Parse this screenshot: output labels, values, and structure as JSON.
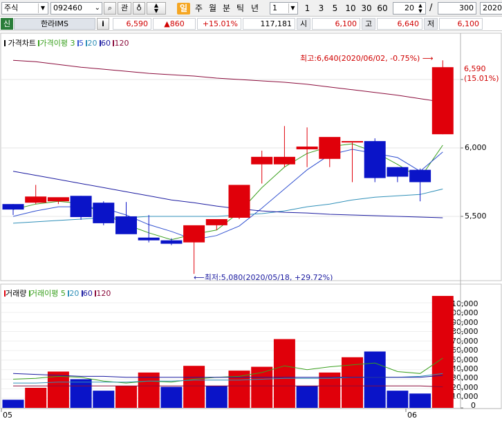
{
  "toolbar": {
    "market": "주식",
    "code": "092460",
    "gwan": "관",
    "periods": [
      "일",
      "주",
      "월",
      "분",
      "틱",
      "년"
    ],
    "selected_period": "일",
    "unit_value": "1",
    "intervals": [
      "1",
      "3",
      "5",
      "10",
      "30",
      "60"
    ],
    "count_value": "20",
    "slash": "/",
    "total_value": "300",
    "date_value": "2020/"
  },
  "infobar": {
    "credit_tag": "신",
    "name": "한라IMS",
    "info_button": "i",
    "price": "6,590",
    "change": "▲860",
    "change_pct": "+15.01%",
    "volume": "117,181",
    "open_label": "시",
    "open_value": "6,100",
    "high_label": "고",
    "high_value": "6,640",
    "low_label": "저",
    "low_value": "6,100"
  },
  "colors": {
    "up": "#e0000a",
    "down": "#0a14c8",
    "ma3": "#3aa01e",
    "ma5": "#3050d0",
    "ma20": "#2e8fb8",
    "ma60": "#1a1aa0",
    "ma120": "#8a0a3a",
    "label_red": "#d00000"
  },
  "price_panel": {
    "title": "가격차트",
    "ma_title": "가격이평",
    "ma_periods": [
      "3",
      "5",
      "20",
      "60",
      "120"
    ],
    "max_annotation": "최고:6,640(2020/06/02, -0.75%)",
    "min_annotation": "최저:5,080(2020/05/18, +29.72%)",
    "last_price": "6,590",
    "last_pct": "(15.01%)",
    "y_ticks": [
      "6,000",
      "5,500"
    ]
  },
  "volume_panel": {
    "title": "거래량",
    "ma_title": "거래이평",
    "ma_periods": [
      "5",
      "20",
      "60",
      "120"
    ],
    "y_ticks": [
      "110,000",
      "100,000",
      "90,000",
      "80,000",
      "70,000",
      "60,000",
      "50,000",
      "40,000",
      "30,000",
      "20,000",
      "10,000",
      "0"
    ]
  },
  "x_labels": [
    "05",
    "06"
  ],
  "chart_data": [
    {
      "type": "candlestick",
      "title": "가격차트",
      "x": [
        "2020/05/06",
        "2020/05/07",
        "2020/05/08",
        "2020/05/11",
        "2020/05/12",
        "2020/05/13",
        "2020/05/14",
        "2020/05/15",
        "2020/05/18",
        "2020/05/19",
        "2020/05/20",
        "2020/05/21",
        "2020/05/22",
        "2020/05/25",
        "2020/05/26",
        "2020/05/27",
        "2020/05/28",
        "2020/05/29",
        "2020/06/01",
        "2020/06/02"
      ],
      "open": [
        5590,
        5600,
        5610,
        5650,
        5600,
        5500,
        5345,
        5325,
        5310,
        5435,
        5490,
        5880,
        5880,
        5990,
        5920,
        6045,
        6050,
        5860,
        5840,
        6100
      ],
      "high": [
        5590,
        5730,
        5620,
        5650,
        5610,
        5605,
        5510,
        5340,
        5335,
        5440,
        5720,
        5980,
        6160,
        6150,
        6040,
        6040,
        6070,
        5860,
        5850,
        6640
      ],
      "low": [
        5510,
        5590,
        5590,
        5475,
        5435,
        5435,
        5310,
        5290,
        5080,
        5400,
        5480,
        5740,
        5860,
        5860,
        5860,
        5750,
        5750,
        5750,
        5610,
        6100
      ],
      "close": [
        5550,
        5645,
        5640,
        5495,
        5450,
        5370,
        5325,
        5300,
        5435,
        5480,
        5730,
        5935,
        5935,
        6010,
        6080,
        6050,
        5780,
        5790,
        5750,
        6590
      ],
      "ma": {
        "3": [
          5550,
          5590,
          5610,
          5595,
          5520,
          5440,
          5380,
          5330,
          5370,
          5400,
          5530,
          5710,
          5860,
          5960,
          6010,
          6030,
          5970,
          5880,
          5780,
          6020
        ],
        "5": [
          5500,
          5540,
          5570,
          5570,
          5560,
          5510,
          5440,
          5390,
          5330,
          5360,
          5430,
          5560,
          5700,
          5840,
          5950,
          5990,
          5960,
          5930,
          5830,
          5970
        ],
        "20": [
          5450,
          5460,
          5470,
          5480,
          5490,
          5490,
          5500,
          5500,
          5500,
          5500,
          5510,
          5520,
          5540,
          5570,
          5590,
          5620,
          5640,
          5650,
          5660,
          5700
        ],
        "60": [
          5830,
          5800,
          5770,
          5740,
          5710,
          5680,
          5650,
          5620,
          5600,
          5575,
          5555,
          5540,
          5530,
          5525,
          5515,
          5510,
          5505,
          5500,
          5495,
          5490
        ],
        "120": [
          6640,
          6630,
          6610,
          6590,
          6575,
          6560,
          6545,
          6535,
          6525,
          6510,
          6500,
          6490,
          6480,
          6465,
          6445,
          6425,
          6405,
          6385,
          6360,
          6335
        ]
      },
      "ylim": [
        5000,
        6800
      ]
    },
    {
      "type": "bar",
      "title": "거래량",
      "categories": [
        "2020/05/06",
        "2020/05/07",
        "2020/05/08",
        "2020/05/11",
        "2020/05/12",
        "2020/05/13",
        "2020/05/14",
        "2020/05/15",
        "2020/05/18",
        "2020/05/19",
        "2020/05/20",
        "2020/05/21",
        "2020/05/22",
        "2020/05/25",
        "2020/05/26",
        "2020/05/27",
        "2020/05/28",
        "2020/05/29",
        "2020/06/01",
        "2020/06/02"
      ],
      "values": [
        8500,
        21000,
        38000,
        30000,
        18000,
        23000,
        37000,
        22000,
        44000,
        23000,
        39000,
        43000,
        72000,
        23000,
        37000,
        53000,
        59000,
        18000,
        15000,
        117181
      ],
      "up": [
        false,
        true,
        true,
        false,
        false,
        true,
        true,
        false,
        true,
        false,
        true,
        true,
        true,
        false,
        true,
        true,
        false,
        false,
        false,
        true
      ],
      "ma": {
        "5": [
          30000,
          31000,
          33000,
          32000,
          28000,
          26000,
          28000,
          27000,
          30000,
          32000,
          33000,
          37000,
          44000,
          40000,
          43000,
          45000,
          47000,
          38000,
          36000,
          52000
        ],
        "20": [
          26000,
          26000,
          27000,
          27000,
          27000,
          27000,
          28000,
          28000,
          29000,
          29000,
          29000,
          30000,
          31000,
          31000,
          31000,
          32000,
          32000,
          32000,
          33000,
          36000
        ],
        "60": [
          36000,
          35000,
          34000,
          33000,
          33000,
          32000,
          32000,
          32000,
          32000,
          32000,
          32000,
          32000,
          32000,
          32000,
          32000,
          32000,
          32000,
          32000,
          32000,
          34000
        ],
        "120": [
          23000,
          23000,
          23000,
          23000,
          23000,
          23000,
          23000,
          23000,
          23000,
          23000,
          23000,
          23000,
          23000,
          23000,
          23000,
          23000,
          23000,
          23000,
          23000,
          22000
        ]
      },
      "ylim": [
        0,
        120000
      ]
    }
  ]
}
